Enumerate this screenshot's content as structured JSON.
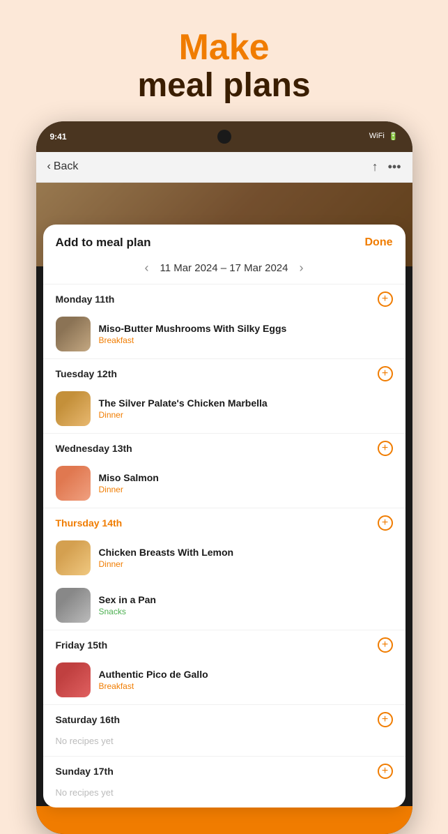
{
  "headline": {
    "make": "Make",
    "sub": "meal plans"
  },
  "device": {
    "status": {
      "time": "9:41",
      "icons": "▪ ▪ ▪"
    },
    "nav": {
      "back_label": "Back",
      "icon_share": "↑",
      "icon_more": "•••"
    }
  },
  "modal": {
    "title": "Add to meal plan",
    "done_label": "Done",
    "date_range": "11 Mar 2024 – 17 Mar 2024",
    "days": [
      {
        "id": "monday",
        "label": "Monday 11th",
        "highlight": false,
        "recipes": [
          {
            "name": "Miso-Butter Mushrooms With Silky Eggs",
            "type": "Breakfast",
            "type_class": "breakfast",
            "thumb_class": "thumb-mushroom"
          }
        ]
      },
      {
        "id": "tuesday",
        "label": "Tuesday 12th",
        "highlight": false,
        "recipes": [
          {
            "name": "The Silver Palate's Chicken Marbella",
            "type": "Dinner",
            "type_class": "dinner",
            "thumb_class": "thumb-chicken"
          }
        ]
      },
      {
        "id": "wednesday",
        "label": "Wednesday 13th",
        "highlight": false,
        "recipes": [
          {
            "name": "Miso Salmon",
            "type": "Dinner",
            "type_class": "dinner",
            "thumb_class": "thumb-salmon"
          }
        ]
      },
      {
        "id": "thursday",
        "label": "Thursday 14th",
        "highlight": true,
        "recipes": [
          {
            "name": "Chicken Breasts With Lemon",
            "type": "Dinner",
            "type_class": "dinner",
            "thumb_class": "thumb-chicken2"
          },
          {
            "name": "Sex in a Pan",
            "type": "Snacks",
            "type_class": "snacks",
            "thumb_class": "thumb-pan"
          }
        ]
      },
      {
        "id": "friday",
        "label": "Friday 15th",
        "highlight": false,
        "recipes": [
          {
            "name": "Authentic Pico de Gallo",
            "type": "Breakfast",
            "type_class": "breakfast",
            "thumb_class": "thumb-pico"
          }
        ]
      },
      {
        "id": "saturday",
        "label": "Saturday 16th",
        "highlight": false,
        "recipes": [],
        "empty_label": "No recipes yet"
      },
      {
        "id": "sunday",
        "label": "Sunday 17th",
        "highlight": false,
        "recipes": [],
        "empty_label": "No recipes yet"
      }
    ]
  }
}
